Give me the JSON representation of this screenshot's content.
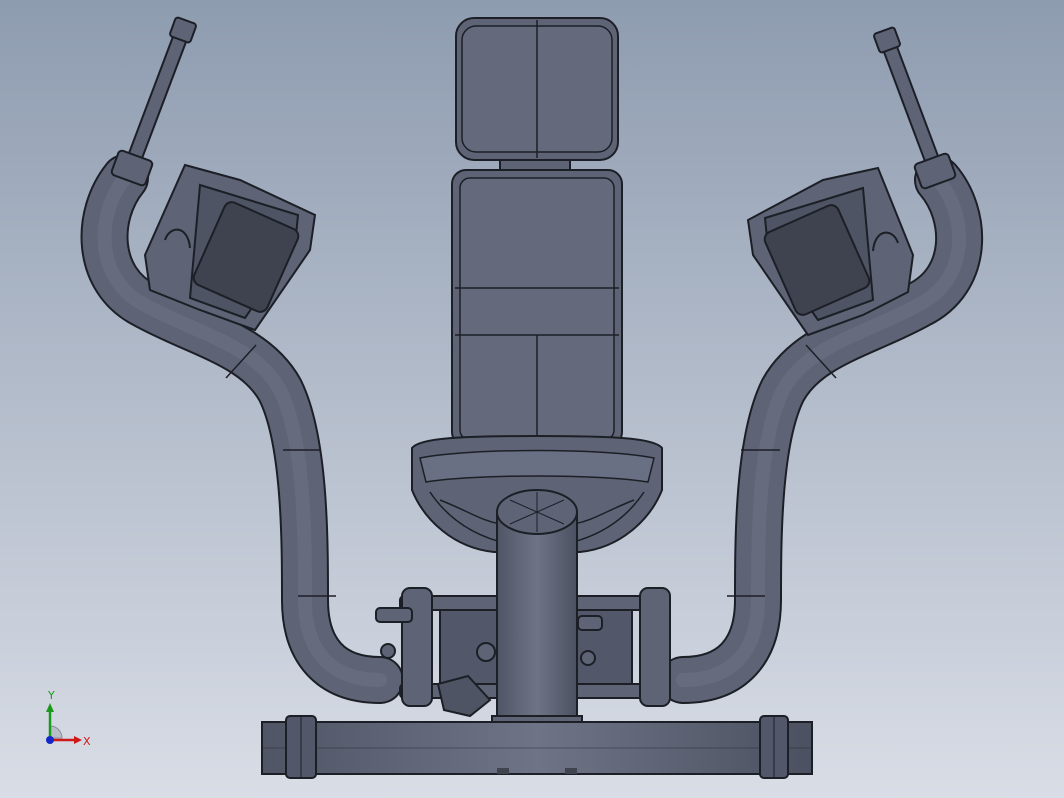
{
  "scene": {
    "model_name": "",
    "colors": {
      "background_top": "#8e9cb0",
      "background_bottom": "#d9dde6",
      "part_fill": "#5e6475",
      "part_fill_light": "#6d7385",
      "edge": "#1d1f27"
    }
  },
  "triad": {
    "x_label": "X",
    "y_label": "Y",
    "x_color": "#d01818",
    "y_color": "#1a9a1a",
    "z_color": "#1428c8"
  }
}
